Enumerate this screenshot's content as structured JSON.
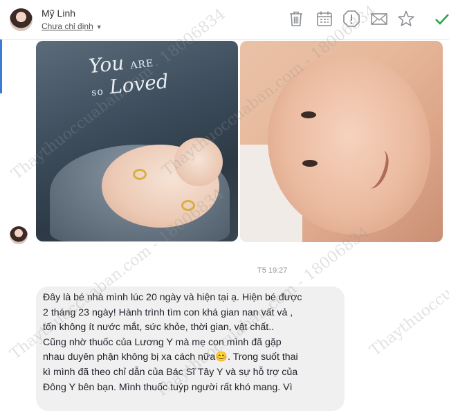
{
  "header": {
    "sender_name": "Mỹ Linh",
    "sender_subtitle": "Chưa chỉ định",
    "actions": [
      {
        "name": "trash-icon",
        "color": "#8a8d91"
      },
      {
        "name": "calendar-icon",
        "color": "#8a8d91"
      },
      {
        "name": "alert-icon",
        "color": "#8a8d91"
      },
      {
        "name": "mail-icon",
        "color": "#8a8d91"
      },
      {
        "name": "star-icon",
        "color": "#8a8d91"
      },
      {
        "name": "check-icon",
        "color": "#2ea44f"
      }
    ]
  },
  "photo_left": {
    "overlay_word1": "You",
    "overlay_word2": "ARE",
    "overlay_word3": "so",
    "overlay_word4": "Loved"
  },
  "message": {
    "timestamp": "T5 19:27",
    "lines": [
      "Đây là bé nhà mình lúc 20 ngày và hiện tại ạ. Hiện bé được",
      "2 tháng 23 ngày! Hành trình tìm con khá gian nan vất vả ,",
      "tốn không ít nước mắt, sức khỏe, thời gian, vật chất..",
      "Cũng nhờ thuốc của Lương Y mà mẹ con mình đã gặp",
      "nhau duyên phận không bị xa cách nữa😊. Trong suốt thai",
      "kì mình đã theo chỉ dẫn của Bác Sĩ Tây Y và sự hỗ trợ của",
      "Đông Y bên bạn. Mình thuốc tuýp người rất khó mang. Vì"
    ]
  },
  "watermarks": {
    "w1": "Thaythuoccuaban.com - 18006834",
    "w2": "Thaythuoccuaban.com - 18006834",
    "w3": "Thaythuoccuaban.com - 18006834",
    "w4": "Thaythuoccuaban.com - 18006834",
    "w5": "Thaythuoccuaban"
  },
  "colors": {
    "accent": "#3a7bd5",
    "bubble": "#f1f0f0",
    "check": "#2ea44f"
  }
}
